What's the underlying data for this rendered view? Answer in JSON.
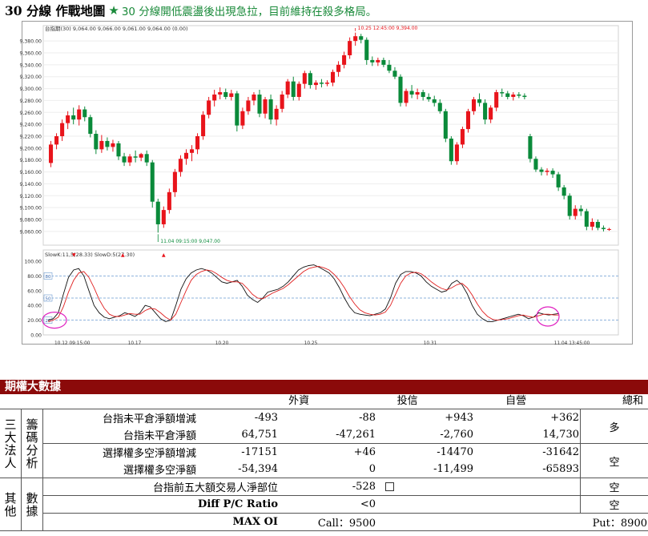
{
  "header": {
    "title": "30 分線 作戰地圖",
    "star_icon": "star-icon",
    "subtitle": "30 分線開低震盪後出現急拉，目前維持在殺多格局。"
  },
  "chart_data": [
    {
      "type": "candlestick",
      "title": "",
      "info_bar": "  台指期(30)  9,064.00  9,066.00  9,061.00  9,064.00  (0.00)",
      "y_ticks": [
        "9,380.00",
        "9,360.00",
        "9,340.00",
        "9,320.00",
        "9,300.00",
        "9,280.00",
        "9,260.00",
        "9,240.00",
        "9,220.00",
        "9,200.00",
        "9,180.00",
        "9,160.00",
        "9,140.00",
        "9,120.00",
        "9,100.00",
        "9,080.00",
        "9,060.00"
      ],
      "ylim": [
        9045,
        9395
      ],
      "high_annotation": "10.25 12:45:00 9,394.00",
      "low_annotation": "11.04 09:15:00  9,047.00",
      "up_color": "#e8141b",
      "down_color": "#0a8a3a",
      "candles": [
        [
          9175,
          9212,
          9168,
          9206
        ],
        [
          9206,
          9225,
          9198,
          9220
        ],
        [
          9220,
          9248,
          9212,
          9242
        ],
        [
          9242,
          9262,
          9232,
          9255
        ],
        [
          9255,
          9268,
          9240,
          9248
        ],
        [
          9248,
          9272,
          9238,
          9265
        ],
        [
          9265,
          9270,
          9245,
          9252
        ],
        [
          9252,
          9256,
          9218,
          9224
        ],
        [
          9224,
          9230,
          9190,
          9198
        ],
        [
          9198,
          9222,
          9192,
          9212
        ],
        [
          9212,
          9218,
          9196,
          9202
        ],
        [
          9202,
          9214,
          9194,
          9208
        ],
        [
          9208,
          9212,
          9180,
          9186
        ],
        [
          9186,
          9192,
          9170,
          9176
        ],
        [
          9176,
          9190,
          9170,
          9186
        ],
        [
          9186,
          9196,
          9176,
          9184
        ],
        [
          9184,
          9192,
          9178,
          9190
        ],
        [
          9190,
          9196,
          9170,
          9176
        ],
        [
          9176,
          9180,
          9100,
          9110
        ],
        [
          9110,
          9115,
          9058,
          9072
        ],
        [
          9072,
          9102,
          9066,
          9096
        ],
        [
          9096,
          9132,
          9090,
          9126
        ],
        [
          9126,
          9165,
          9118,
          9160
        ],
        [
          9160,
          9188,
          9152,
          9182
        ],
        [
          9182,
          9198,
          9172,
          9192
        ],
        [
          9192,
          9205,
          9178,
          9198
        ],
        [
          9198,
          9225,
          9190,
          9220
        ],
        [
          9220,
          9262,
          9214,
          9256
        ],
        [
          9256,
          9286,
          9250,
          9280
        ],
        [
          9280,
          9298,
          9270,
          9290
        ],
        [
          9290,
          9302,
          9282,
          9294
        ],
        [
          9294,
          9300,
          9282,
          9286
        ],
        [
          9286,
          9298,
          9280,
          9292
        ],
        [
          9292,
          9296,
          9228,
          9238
        ],
        [
          9238,
          9268,
          9232,
          9262
        ],
        [
          9262,
          9286,
          9256,
          9280
        ],
        [
          9280,
          9294,
          9272,
          9290
        ],
        [
          9290,
          9298,
          9252,
          9258
        ],
        [
          9258,
          9286,
          9250,
          9282
        ],
        [
          9282,
          9290,
          9240,
          9248
        ],
        [
          9248,
          9272,
          9238,
          9266
        ],
        [
          9266,
          9296,
          9260,
          9290
        ],
        [
          9290,
          9316,
          9284,
          9312
        ],
        [
          9312,
          9320,
          9280,
          9286
        ],
        [
          9286,
          9312,
          9280,
          9308
        ],
        [
          9308,
          9330,
          9300,
          9326
        ],
        [
          9326,
          9330,
          9300,
          9306
        ],
        [
          9306,
          9314,
          9298,
          9310
        ],
        [
          9310,
          9316,
          9302,
          9308
        ],
        [
          9308,
          9314,
          9304,
          9310
        ],
        [
          9310,
          9332,
          9304,
          9328
        ],
        [
          9328,
          9346,
          9320,
          9340
        ],
        [
          9340,
          9362,
          9334,
          9356
        ],
        [
          9356,
          9386,
          9350,
          9380
        ],
        [
          9380,
          9394,
          9372,
          9388
        ],
        [
          9388,
          9392,
          9376,
          9382
        ],
        [
          9382,
          9386,
          9340,
          9348
        ],
        [
          9348,
          9354,
          9338,
          9344
        ],
        [
          9344,
          9352,
          9338,
          9348
        ],
        [
          9348,
          9352,
          9336,
          9340
        ],
        [
          9340,
          9348,
          9326,
          9330
        ],
        [
          9330,
          9336,
          9316,
          9320
        ],
        [
          9320,
          9324,
          9270,
          9276
        ],
        [
          9276,
          9300,
          9270,
          9296
        ],
        [
          9296,
          9306,
          9284,
          9290
        ],
        [
          9290,
          9300,
          9282,
          9294
        ],
        [
          9294,
          9298,
          9280,
          9286
        ],
        [
          9286,
          9292,
          9278,
          9282
        ],
        [
          9282,
          9288,
          9270,
          9276
        ],
        [
          9276,
          9282,
          9258,
          9262
        ],
        [
          9262,
          9266,
          9210,
          9216
        ],
        [
          9216,
          9220,
          9172,
          9178
        ],
        [
          9178,
          9210,
          9172,
          9206
        ],
        [
          9206,
          9236,
          9200,
          9232
        ],
        [
          9232,
          9266,
          9226,
          9262
        ],
        [
          9262,
          9286,
          9256,
          9282
        ],
        [
          9282,
          9292,
          9270,
          9276
        ],
        [
          9276,
          9282,
          9240,
          9248
        ],
        [
          9248,
          9272,
          9242,
          9268
        ],
        [
          9268,
          9298,
          9262,
          9294
        ],
        [
          9294,
          9300,
          9286,
          9292
        ],
        [
          9292,
          9296,
          9282,
          9286
        ],
        [
          9286,
          9294,
          9280,
          9290
        ],
        [
          9290,
          9294,
          9284,
          9288
        ],
        [
          9288,
          9292,
          9282,
          9286
        ],
        [
          9220,
          9224,
          9176,
          9182
        ],
        [
          9182,
          9186,
          9160,
          9164
        ],
        [
          9164,
          9168,
          9154,
          9160
        ],
        [
          9160,
          9166,
          9154,
          9162
        ],
        [
          9162,
          9166,
          9150,
          9156
        ],
        [
          9156,
          9160,
          9128,
          9134
        ],
        [
          9134,
          9138,
          9114,
          9120
        ],
        [
          9120,
          9124,
          9080,
          9086
        ],
        [
          9086,
          9104,
          9080,
          9098
        ],
        [
          9098,
          9104,
          9086,
          9094
        ],
        [
          9094,
          9098,
          9062,
          9068
        ],
        [
          9068,
          9082,
          9062,
          9076
        ],
        [
          9076,
          9080,
          9062,
          9066
        ],
        [
          9066,
          9070,
          9060,
          9064
        ],
        [
          9064,
          9066,
          9061,
          9064
        ]
      ]
    },
    {
      "type": "line",
      "title": "",
      "info_bar": "SlowK:11,5(28.33)  SlowD:5(27.30)",
      "y_ticks": [
        "100.00",
        "80.00",
        "60.00",
        "40.00",
        "20.00",
        "0.00"
      ],
      "ylim": [
        0,
        100
      ],
      "ref_lines": [
        80,
        50,
        20
      ],
      "ref_labels": [
        "80",
        "50",
        "20"
      ],
      "x_tick_labels": [
        "10.12 09:15:00",
        "10.17",
        "10.20",
        "10.25",
        "10.31",
        "11.04 13:45:00"
      ],
      "series": [
        {
          "name": "SlowK",
          "color": "#111111",
          "values": [
            20,
            22,
            30,
            55,
            78,
            88,
            90,
            80,
            60,
            40,
            30,
            24,
            22,
            24,
            26,
            30,
            28,
            25,
            30,
            40,
            38,
            30,
            22,
            18,
            20,
            40,
            62,
            76,
            84,
            88,
            90,
            88,
            84,
            78,
            72,
            70,
            72,
            74,
            66,
            54,
            48,
            44,
            50,
            58,
            60,
            62,
            66,
            72,
            80,
            88,
            92,
            94,
            95,
            92,
            88,
            84,
            76,
            64,
            50,
            38,
            30,
            28,
            27,
            26,
            28,
            30,
            35,
            50,
            70,
            82,
            86,
            86,
            84,
            80,
            72,
            66,
            62,
            58,
            60,
            70,
            74,
            68,
            56,
            40,
            28,
            22,
            18,
            18,
            20,
            22,
            24,
            26,
            28,
            26,
            22,
            24,
            30,
            28,
            27,
            28,
            29
          ]
        },
        {
          "name": "SlowD",
          "color": "#e02020",
          "values": [
            18,
            20,
            24,
            38,
            58,
            74,
            84,
            86,
            78,
            64,
            48,
            36,
            28,
            25,
            25,
            27,
            29,
            28,
            28,
            33,
            36,
            35,
            30,
            24,
            20,
            28,
            44,
            60,
            74,
            82,
            86,
            88,
            87,
            83,
            78,
            74,
            72,
            72,
            70,
            63,
            55,
            50,
            49,
            53,
            57,
            60,
            63,
            68,
            74,
            80,
            86,
            90,
            92,
            93,
            91,
            88,
            82,
            74,
            64,
            52,
            42,
            34,
            30,
            28,
            27,
            28,
            31,
            40,
            55,
            70,
            80,
            84,
            85,
            83,
            78,
            72,
            67,
            63,
            61,
            64,
            68,
            70,
            64,
            54,
            42,
            32,
            25,
            21,
            20,
            21,
            22,
            24,
            26,
            27,
            25,
            24,
            26,
            28,
            28,
            27,
            27
          ]
        }
      ]
    }
  ],
  "table": {
    "header_title": "期權大數據",
    "columns": [
      "外資",
      "投信",
      "自營",
      "總和",
      "多/空"
    ],
    "group1_label": [
      "三",
      "籌",
      "大",
      "碼",
      "法",
      "分",
      "人",
      "析"
    ],
    "group2_label": [
      "其",
      "數",
      "他",
      "據"
    ],
    "rows": [
      {
        "label": "台指未平倉淨額增減",
        "v1": "-493",
        "v2": "-88",
        "v3": "+943",
        "v4": "+362"
      },
      {
        "label": "台指未平倉淨額",
        "v1": "64,751",
        "v2": "-47,261",
        "v3": "-2,760",
        "v4": "14,730"
      },
      {
        "label": "選擇權多空淨額增減",
        "v1": "-17151",
        "v2": "+46",
        "v3": "-14470",
        "v4": "-31642"
      },
      {
        "label": "選擇權多空淨額",
        "v1": "-54,394",
        "v2": "0",
        "v3": "-11,499",
        "v4": "-65893"
      }
    ],
    "verdict_futures": "多",
    "verdict_options": "空",
    "top5_label": "台指前五大額交易人淨部位",
    "top5_value": "-528",
    "top5_verdict": "空",
    "pc_label": "Diff P/C Ratio",
    "pc_value": "<0",
    "pc_verdict": "空",
    "maxoi_label": "MAX OI",
    "call_text": "Call：9500",
    "put_text": "Put：8900"
  }
}
